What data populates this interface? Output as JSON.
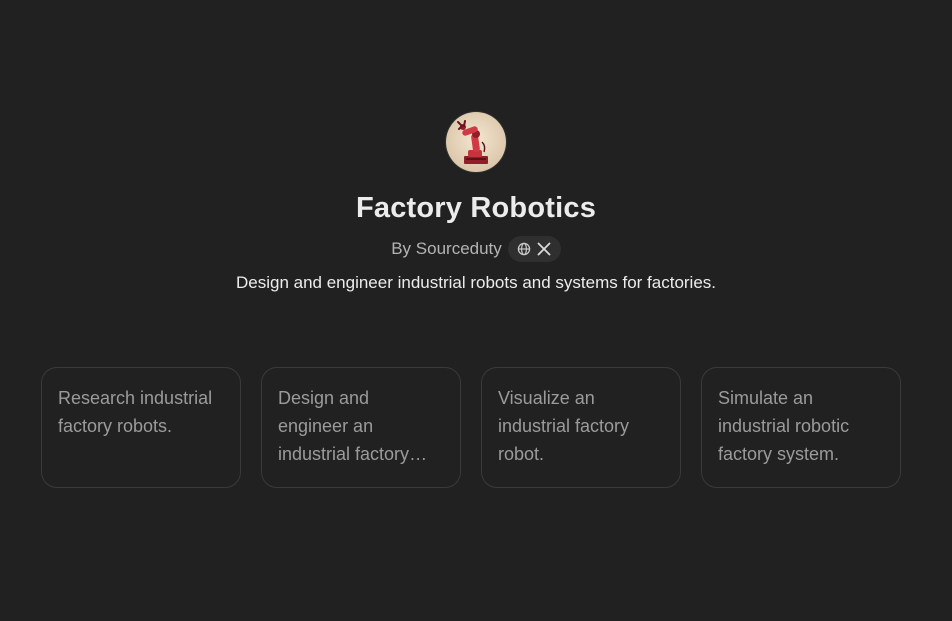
{
  "gpt": {
    "name": "Factory Robotics",
    "byline": "By Sourceduty",
    "description": "Design and engineer industrial robots and systems for factories.",
    "avatar_icon": "industrial-robot-arm-icon",
    "social_icons": [
      "globe-icon",
      "x-icon"
    ]
  },
  "conversation_starters": [
    {
      "text": "Research industrial factory robots."
    },
    {
      "text": "Design and engineer an industrial factory robot for an assembly line."
    },
    {
      "text": "Visualize an industrial factory robot."
    },
    {
      "text": "Simulate an industrial robotic factory system."
    }
  ],
  "colors": {
    "background": "#212121",
    "title": "#ececec",
    "muted": "#b4b4b4",
    "card_border": "#3a3a3a",
    "card_text": "#9b9b9b",
    "pill": "#2f2f2f",
    "robot_red": "#c8323c"
  }
}
